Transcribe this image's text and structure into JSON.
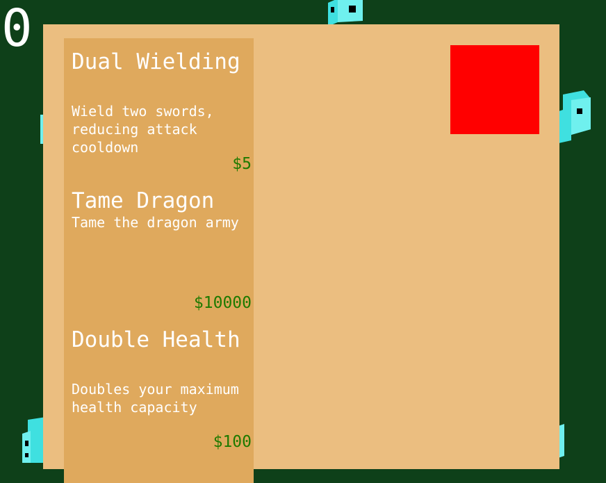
{
  "hud": {
    "score": "0"
  },
  "shop": {
    "items": [
      {
        "title": "Dual Wielding",
        "description": "Wield two swords, reducing attack cooldown",
        "price": "$5"
      },
      {
        "title": "Tame Dragon",
        "description": "Tame the dragon army",
        "price": "$10000"
      },
      {
        "title": "Double Health",
        "description": "Doubles your maximum health capacity",
        "price": "$100"
      }
    ]
  },
  "colors": {
    "background": "#0e4019",
    "panel": "#ebbe80",
    "list": "#dfa95d",
    "price": "#1e7a00",
    "close": "#ff0000",
    "dice": "#3fe0e0"
  }
}
